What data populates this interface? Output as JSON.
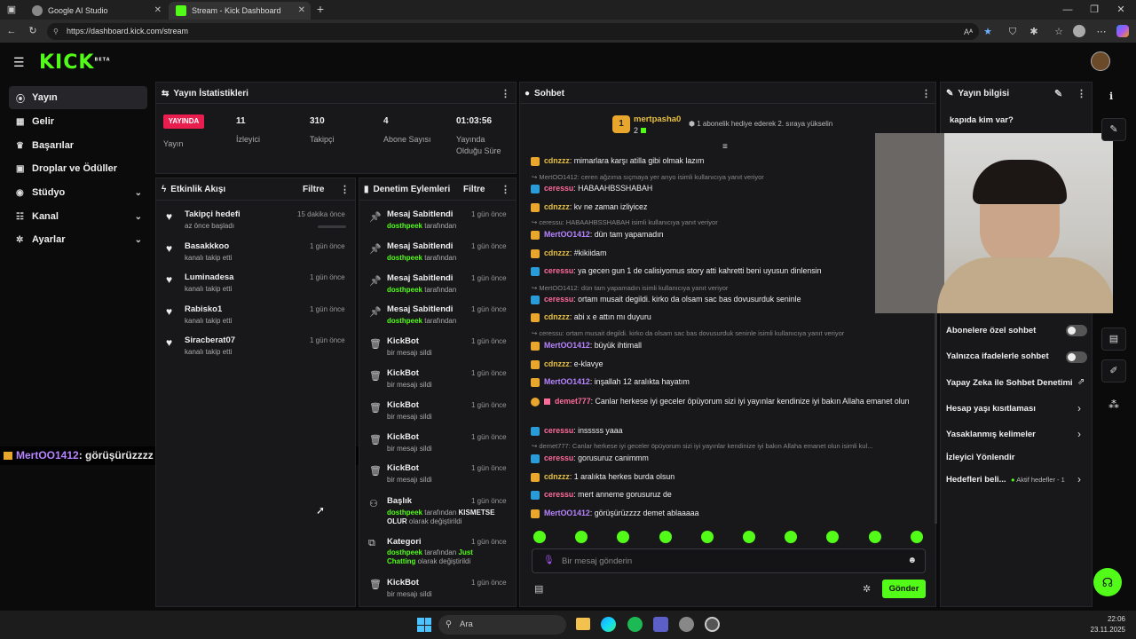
{
  "browser": {
    "tabs": [
      {
        "label": "Google AI Studio"
      },
      {
        "label": "Stream - Kick Dashboard"
      }
    ],
    "url": "https://dashboard.kick.com/stream"
  },
  "app": {
    "logo": "KICK",
    "logo_badge": "BETA"
  },
  "sidebar": {
    "items": [
      {
        "label": "Yayın",
        "icon": "broadcast-icon"
      },
      {
        "label": "Gelir",
        "icon": "dollar-icon"
      },
      {
        "label": "Başarılar",
        "icon": "trophy-icon"
      },
      {
        "label": "Droplar ve Ödüller",
        "icon": "gift-icon"
      },
      {
        "label": "Stüdyo",
        "icon": "studio-icon"
      },
      {
        "label": "Kanal",
        "icon": "channel-icon"
      },
      {
        "label": "Ayarlar",
        "icon": "gear-icon"
      }
    ]
  },
  "stats": {
    "title": "Yayın İstatistikleri",
    "live_badge": "YAYINDA",
    "yayin_label": "Yayın",
    "items": [
      {
        "value": "11",
        "label": "İzleyici"
      },
      {
        "value": "310",
        "label": "Takipçi"
      },
      {
        "value": "4",
        "label": "Abone Sayısı"
      },
      {
        "value": "01:03:56",
        "label": "Yayında Olduğu Süre"
      }
    ]
  },
  "activity": {
    "title": "Etkinlik Akışı",
    "filter": "Filtre",
    "items": [
      {
        "title": "Takipçi hedefi",
        "sub": "az önce başladı",
        "time": "15 dakika önce"
      },
      {
        "title": "Basakkkoo",
        "sub": "kanalı takip etti",
        "time": "1 gün önce"
      },
      {
        "title": "Luminadesa",
        "sub": "kanalı takip etti",
        "time": "1 gün önce"
      },
      {
        "title": "Rabisko1",
        "sub": "kanalı takip etti",
        "time": "1 gün önce"
      },
      {
        "title": "Siracberat07",
        "sub": "kanalı takip etti",
        "time": "1 gün önce"
      }
    ]
  },
  "moderation": {
    "title": "Denetim Eylemleri",
    "filter": "Filtre",
    "items": [
      {
        "title": "Mesaj Sabitlendi",
        "user": "dosthpeek",
        "sub": "tarafından",
        "time": "1 gün önce"
      },
      {
        "title": "Mesaj Sabitlendi",
        "user": "dosthpeek",
        "sub": "tarafından",
        "time": "1 gün önce"
      },
      {
        "title": "Mesaj Sabitlendi",
        "user": "dosthpeek",
        "sub": "tarafından",
        "time": "1 gün önce"
      },
      {
        "title": "Mesaj Sabitlendi",
        "user": "dosthpeek",
        "sub": "tarafından",
        "time": "1 gün önce"
      },
      {
        "title": "KickBot",
        "user": "",
        "sub": "bir mesajı sildi",
        "time": "1 gün önce"
      },
      {
        "title": "KickBot",
        "user": "",
        "sub": "bir mesajı sildi",
        "time": "1 gün önce"
      },
      {
        "title": "KickBot",
        "user": "",
        "sub": "bir mesajı sildi",
        "time": "1 gün önce"
      },
      {
        "title": "KickBot",
        "user": "",
        "sub": "bir mesajı sildi",
        "time": "1 gün önce"
      },
      {
        "title": "KickBot",
        "user": "",
        "sub": "bir mesajı sildi",
        "time": "1 gün önce"
      }
    ],
    "title_change": {
      "title": "Başlık",
      "user": "dosthpeek",
      "pre": "tarafından",
      "value": "KISMETSE OLUR",
      "post": "olarak değiştirildi",
      "time": "1 gün önce"
    },
    "category_change": {
      "title": "Kategori",
      "user": "dosthpeek",
      "pre": "tarafından",
      "value": "Just Chatting",
      "post": "olarak değiştirildi",
      "time": "1 gün önce"
    },
    "last": {
      "title": "KickBot",
      "sub": "bir mesajı sildi",
      "time": "1 gün önce"
    }
  },
  "chat": {
    "title": "Sohbet",
    "gifter": {
      "rank": "1",
      "name": "mertpasha0",
      "count": "2",
      "text": "1 abonelik hediye ederek 2. sıraya yükselin"
    },
    "messages": [
      {
        "user": "cdnzzz",
        "text": ": mimarlara karşı atilla gibi olmak lazım"
      },
      {
        "reply": "MertOO1412: ceren ağzıma sıçmaya yer arıyo isimli kullanıcıya yanıt veriyor"
      },
      {
        "user": "ceressu",
        "text": ": HABAAHBSSHABAH"
      },
      {
        "user": "cdnzzz",
        "text": ": kv ne zaman izliyicez"
      },
      {
        "reply": "ceressu: HABAAHBSSHABAH isimli kullanıcıya yanıt veriyor"
      },
      {
        "user": "MertOO1412",
        "text": ": dün tam yapamadın"
      },
      {
        "user": "cdnzzz",
        "text": ": #kikiidam"
      },
      {
        "user": "ceressu",
        "text": ": ya gecen gun 1 de calisiyomus story atti kahretti beni uyusun dinlensin"
      },
      {
        "reply": "MertOO1412: dün tam yapamadın isimli kullanıcıya yanıt veriyor"
      },
      {
        "user": "ceressu",
        "text": ": ortam musait degildi. kirko da olsam sac bas dovusurduk seninle"
      },
      {
        "user": "cdnzzz",
        "text": ": abi x e attın mı duyuru"
      },
      {
        "reply": "ceressu: ortam musait degildi. kirko da olsam sac bas dovusurduk seninle isimli kullanıcıya yanıt veriyor"
      },
      {
        "user": "MertOO1412",
        "text": ": büyük ihtimall"
      },
      {
        "user": "cdnzzz",
        "text": ": e-klavye"
      },
      {
        "user": "MertOO1412",
        "text": ": inşallah 12 aralıkta hayatım"
      },
      {
        "user": "demet777",
        "text": ": Canlar herkese iyi geceler öpüyorum sizi iyi yayınlar kendinize iyi bakın Allaha emanet olun"
      },
      {
        "user": "ceressu",
        "text": ": insssss yaaa"
      },
      {
        "reply": "demet777: Canlar herkese iyi geceler öpüyorum sizi iyi yayınlar kendinize iyi bakın Allaha emanet olun isimli kul..."
      },
      {
        "user": "ceressu",
        "text": ": gorusuruz canimmm"
      },
      {
        "user": "cdnzzz",
        "text": ": 1 aralıkta herkes burda olsun"
      },
      {
        "user": "ceressu",
        "text": ": mert anneme gorusuruz de"
      },
      {
        "user": "MertOO1412",
        "text": ": görüşürüzzzz demet ablaaaaa"
      }
    ],
    "overlay": {
      "user": "MertOO1412",
      "text": ": görüşürüzzzz demet ablaaaaa"
    },
    "input_placeholder": "Bir mesaj gönderin",
    "send": "Gönder"
  },
  "streaminfo": {
    "title": "Yayın bilgisi",
    "question": "kapıda kim var?",
    "settings": [
      {
        "label": "Abonelere özel sohbet"
      },
      {
        "label": "Yalnızca ifadelerle sohbet"
      },
      {
        "label": "Yapay Zeka ile Sohbet Denetimi"
      },
      {
        "label": "Hesap yaşı kısıtlaması"
      },
      {
        "label": "Yasaklanmış kelimeler"
      },
      {
        "label": "İzleyici Yönlendir"
      },
      {
        "label": "Hedefleri beli..."
      }
    ],
    "goals_status": "Aktif hedefler - 1"
  },
  "taskbar": {
    "search": "Ara",
    "time": "22:06",
    "date": "23.11.2025"
  },
  "colors": {
    "accent": "#53fc18",
    "live": "#e91e4f",
    "panel": "#18181b"
  }
}
